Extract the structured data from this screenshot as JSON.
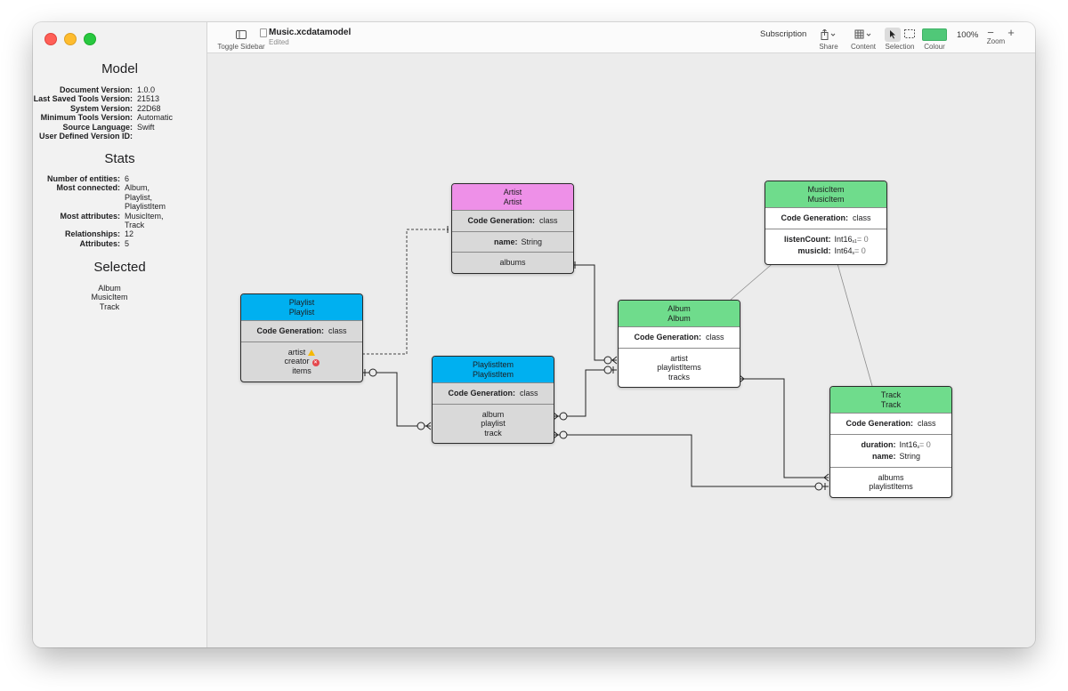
{
  "window": {
    "document_title": "Music.xcdatamodel",
    "document_status": "Edited"
  },
  "toolbar": {
    "toggle_sidebar_label": "Toggle Sidebar",
    "subscription_label": "Subscription",
    "share_label": "Share",
    "content_label": "Content",
    "selection_label": "Selection",
    "colour_label": "Colour",
    "colour_value": "#50c878",
    "zoom_label": "Zoom",
    "zoom_value": "100%",
    "zoom_out": "−",
    "zoom_in": "+"
  },
  "sidebar": {
    "model_title": "Model",
    "model": [
      {
        "k": "Document Version:",
        "v": "1.0.0"
      },
      {
        "k": "Last Saved Tools Version:",
        "v": "21513"
      },
      {
        "k": "System Version:",
        "v": "22D68"
      },
      {
        "k": "Minimum Tools Version:",
        "v": "Automatic"
      },
      {
        "k": "Source Language:",
        "v": "Swift"
      },
      {
        "k": "User Defined Version ID:",
        "v": ""
      }
    ],
    "stats_title": "Stats",
    "stats": {
      "entities_k": "Number of entities:",
      "entities_v": "6",
      "most_connected_k": "Most connected:",
      "most_connected_v": [
        "Album,",
        "Playlist,",
        "PlaylistItem"
      ],
      "most_attributes_k": "Most attributes:",
      "most_attributes_v": [
        "MusicItem,",
        "Track"
      ],
      "relationships_k": "Relationships:",
      "relationships_v": "12",
      "attributes_k": "Attributes:",
      "attributes_v": "5"
    },
    "selected_title": "Selected",
    "selected": [
      "Album",
      "MusicItem",
      "Track"
    ]
  },
  "entities": {
    "artist": {
      "name": "Artist",
      "class": "Artist",
      "color": "#ee90e8",
      "codegen_k": "Code Generation:",
      "codegen_v": "class",
      "attrs": [
        {
          "k": "name:",
          "v": "String"
        }
      ],
      "rels": [
        "albums"
      ]
    },
    "playlist": {
      "name": "Playlist",
      "class": "Playlist",
      "color": "#00b0f0",
      "codegen_k": "Code Generation:",
      "codegen_v": "class",
      "rels": [
        "artist",
        "creator",
        "items"
      ]
    },
    "playlistitem": {
      "name": "PlaylistItem",
      "class": "PlaylistItem",
      "color": "#00b0f0",
      "codegen_k": "Code Generation:",
      "codegen_v": "class",
      "rels": [
        "album",
        "playlist",
        "track"
      ]
    },
    "album": {
      "name": "Album",
      "class": "Album",
      "color": "#6fdc8c",
      "codegen_k": "Code Generation:",
      "codegen_v": "class",
      "rels": [
        "artist",
        "playlistItems",
        "tracks"
      ]
    },
    "musicitem": {
      "name": "MusicItem",
      "class": "MusicItem",
      "color": "#6fdc8c",
      "codegen_k": "Code Generation:",
      "codegen_v": "class",
      "attrs": [
        {
          "k": "listenCount:",
          "v": "Int16",
          "sub": "s1",
          "def": "= 0"
        },
        {
          "k": "musicId:",
          "v": "Int64",
          "sub": "s",
          "def": "= 0"
        }
      ]
    },
    "track": {
      "name": "Track",
      "class": "Track",
      "color": "#6fdc8c",
      "codegen_k": "Code Generation:",
      "codegen_v": "class",
      "attrs": [
        {
          "k": "duration:",
          "v": "Int16",
          "sub": "s",
          "def": "= 0"
        },
        {
          "k": "name:",
          "v": "String"
        }
      ],
      "rels": [
        "albums",
        "playlistItems"
      ]
    }
  },
  "colors": {
    "canvas": "#ececec",
    "sidebar": "#f2f2f2",
    "selected_fill": "#ffffff",
    "unselected_fill": "#d9d9d9"
  }
}
